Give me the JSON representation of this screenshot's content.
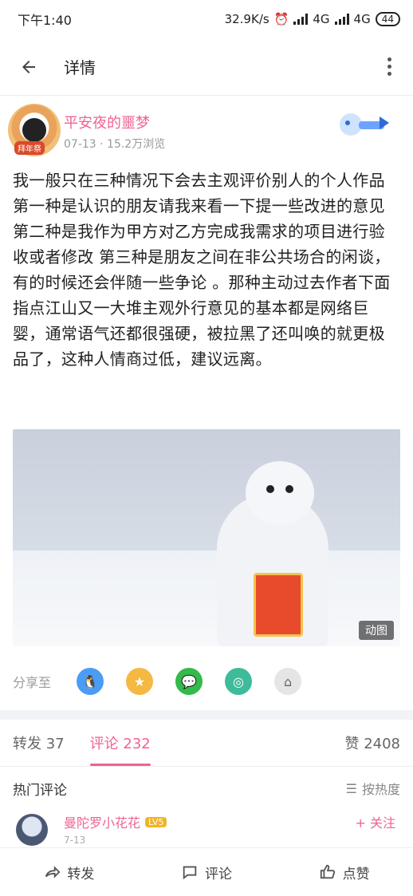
{
  "status": {
    "time": "下午1:40",
    "speed": "32.9K/s",
    "net1": "4G",
    "net2": "4G",
    "battery": "44"
  },
  "header": {
    "title": "详情"
  },
  "author": {
    "name": "平安夜的噩梦",
    "meta": "07-13 · 15.2万浏览",
    "badge": "拜年祭"
  },
  "post": {
    "text": "我一般只在三种情况下会去主观评价别人的个人作品 第一种是认识的朋友请我来看一下提一些改进的意见 第二种是我作为甲方对乙方完成我需求的项目进行验收或者修改 第三种是朋友之间在非公共场合的闲谈，有的时候还会伴随一些争论 。那种主动过去作者下面指点江山又一大堆主观外行意见的基本都是网络巨婴，通常语气还都很强硬，被拉黑了还叫唤的就更极品了，这种人情商过低，建议远离。",
    "media_badge": "动图"
  },
  "share": {
    "label": "分享至",
    "icons": [
      "qq-icon",
      "qzone-icon",
      "wechat-icon",
      "moments-icon",
      "weibo-icon"
    ],
    "colors": [
      "#4a9cf5",
      "#f5b842",
      "#34b94b",
      "#3dbb9a",
      "#e5e5e5"
    ]
  },
  "tabs": {
    "repost": "转发 37",
    "comment": "评论 232",
    "likes": "赞 2408"
  },
  "comments": {
    "hot_label": "热门评论",
    "sort_label": "按热度",
    "first": {
      "name": "曼陀罗小花花",
      "level": "LV5",
      "time": "7-13",
      "follow": "+ 关注"
    }
  },
  "bottom": {
    "repost": "转发",
    "comment": "评论",
    "like": "点赞"
  }
}
